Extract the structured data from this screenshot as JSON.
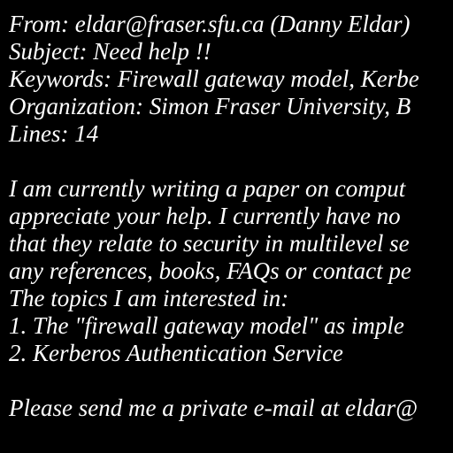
{
  "header": {
    "from": "From: eldar@fraser.sfu.ca (Danny Eldar)",
    "subject": "Subject: Need help !!",
    "keywords": "Keywords: Firewall gateway model, Kerbe",
    "organization": "Organization: Simon Fraser University, B",
    "lines": "Lines: 14"
  },
  "body": {
    "lines": [
      "I am currently writing a paper on comput",
      "appreciate your help.  I currently have no",
      "that they relate to security in multilevel se",
      "any references, books, FAQs or contact pe",
      "The topics I am interested in:",
      "1.  The \"firewall gateway model\" as imple",
      "2.  Kerberos Authentication Service"
    ],
    "closing": "Please send me a private e-mail at eldar@"
  },
  "colors": {
    "background": "#000000",
    "text": "#ffffff"
  }
}
